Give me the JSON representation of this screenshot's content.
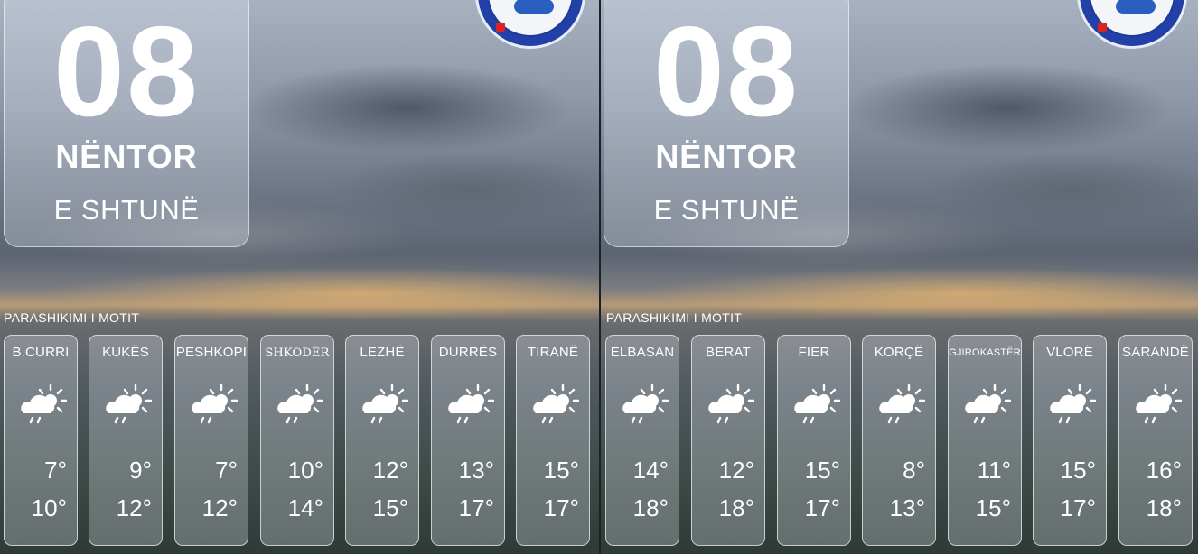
{
  "panels": [
    {
      "day": "08",
      "month": "NËNTOR",
      "weekday": "E SHTUNË",
      "section_title": "PARASHIKIMI I MOTIT",
      "icon": "cloud-sun-rain-icon",
      "cities": [
        {
          "name": "B.CURRI",
          "min": "7°",
          "max": "10°"
        },
        {
          "name": "KUKËS",
          "min": "9°",
          "max": "12°"
        },
        {
          "name": "PESHKOPI",
          "min": "7°",
          "max": "12°"
        },
        {
          "name": "SHKODËR",
          "min": "10°",
          "max": "14°"
        },
        {
          "name": "LEZHË",
          "min": "12°",
          "max": "15°"
        },
        {
          "name": "DURRËS",
          "min": "13°",
          "max": "17°"
        },
        {
          "name": "TIRANË",
          "min": "15°",
          "max": "17°"
        }
      ]
    },
    {
      "day": "08",
      "month": "NËNTOR",
      "weekday": "E SHTUNË",
      "section_title": "PARASHIKIMI I MOTIT",
      "icon": "cloud-sun-rain-icon",
      "cities": [
        {
          "name": "ELBASAN",
          "min": "14°",
          "max": "18°"
        },
        {
          "name": "BERAT",
          "min": "12°",
          "max": "18°"
        },
        {
          "name": "FIER",
          "min": "15°",
          "max": "17°"
        },
        {
          "name": "KORÇË",
          "min": "8°",
          "max": "13°"
        },
        {
          "name": "GJIROKASTËR",
          "min": "11°",
          "max": "15°"
        },
        {
          "name": "VLORË",
          "min": "15°",
          "max": "17°"
        },
        {
          "name": "SARANDË",
          "min": "16°",
          "max": "18°"
        }
      ]
    }
  ],
  "colors": {
    "text": "#ffffff",
    "logo_blue": "#2340a8"
  }
}
